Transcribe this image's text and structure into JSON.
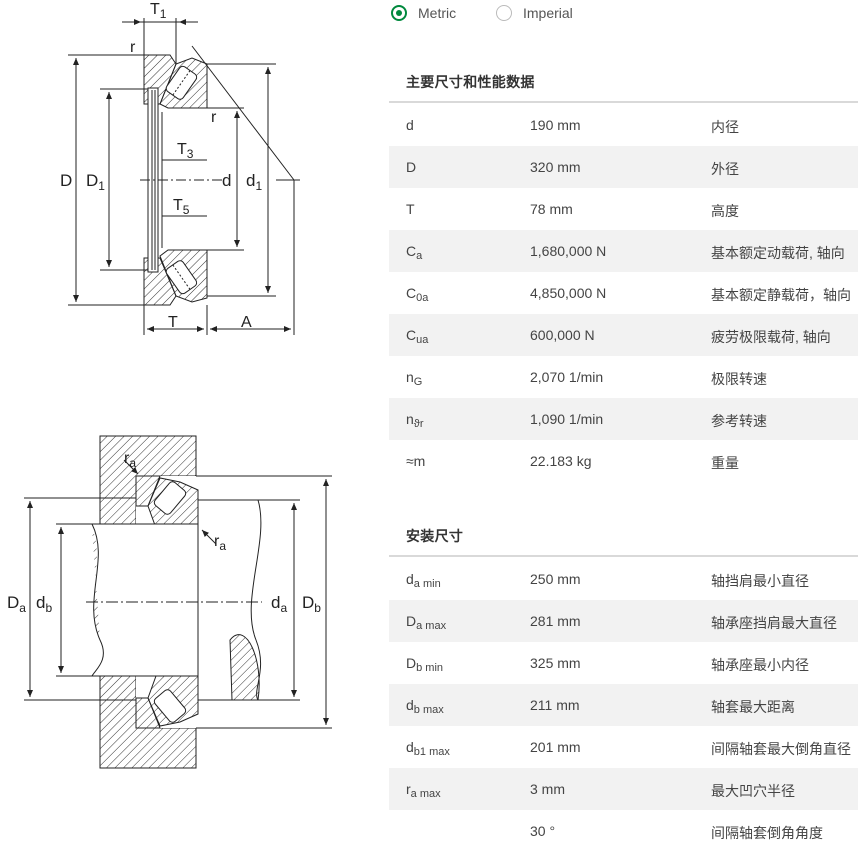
{
  "units": {
    "metric": "Metric",
    "imperial": "Imperial",
    "selected": "metric"
  },
  "diagram_top": {
    "T1": "T1",
    "r_top": "r",
    "r_right": "r",
    "T3": "T3",
    "T5": "T5",
    "D": "D",
    "D1": "D1",
    "d": "d",
    "d1": "d1",
    "T": "T",
    "A": "A"
  },
  "diagram_bottom": {
    "ra_top": "ra",
    "ra_right": "ra",
    "Da": "Da",
    "db": "db",
    "da": "da",
    "Db": "Db"
  },
  "sections": {
    "main": {
      "title": "主要尺寸和性能数据",
      "rows": [
        {
          "sym": "d",
          "sub": "",
          "val": "190 mm",
          "desc": "内径"
        },
        {
          "sym": "D",
          "sub": "",
          "val": "320 mm",
          "desc": "外径"
        },
        {
          "sym": "T",
          "sub": "",
          "val": "78 mm",
          "desc": "高度"
        },
        {
          "sym": "C",
          "sub": "a",
          "val": "1,680,000 N",
          "desc": "基本额定动载荷, 轴向"
        },
        {
          "sym": "C",
          "sub": "0a",
          "val": "4,850,000 N",
          "desc": "基本额定静载荷，轴向"
        },
        {
          "sym": "C",
          "sub": "ua",
          "val": "600,000 N",
          "desc": "疲劳极限载荷, 轴向"
        },
        {
          "sym": "n",
          "sub": "G",
          "val": "2,070 1/min",
          "desc": "极限转速"
        },
        {
          "sym": "n",
          "sub": "ϑr",
          "val": "1,090 1/min",
          "desc": "参考转速"
        },
        {
          "sym": "≈m",
          "sub": "",
          "val": "22.183 kg",
          "desc": "重量"
        }
      ]
    },
    "mount": {
      "title": "安装尺寸",
      "rows": [
        {
          "sym": "d",
          "sub": "a min",
          "val": "250 mm",
          "desc": "轴挡肩最小直径"
        },
        {
          "sym": "D",
          "sub": "a max",
          "val": "281 mm",
          "desc": "轴承座挡肩最大直径"
        },
        {
          "sym": "D",
          "sub": "b min",
          "val": "325 mm",
          "desc": "轴承座最小内径"
        },
        {
          "sym": "d",
          "sub": "b max",
          "val": "211 mm",
          "desc": "轴套最大距离"
        },
        {
          "sym": "d",
          "sub": "b1 max",
          "val": "201 mm",
          "desc": "间隔轴套最大倒角直径"
        },
        {
          "sym": "r",
          "sub": "a max",
          "val": "3 mm",
          "desc": "最大凹穴半径"
        },
        {
          "sym": "",
          "sub": "",
          "val": "30 °",
          "desc": "间隔轴套倒角角度"
        }
      ]
    }
  }
}
